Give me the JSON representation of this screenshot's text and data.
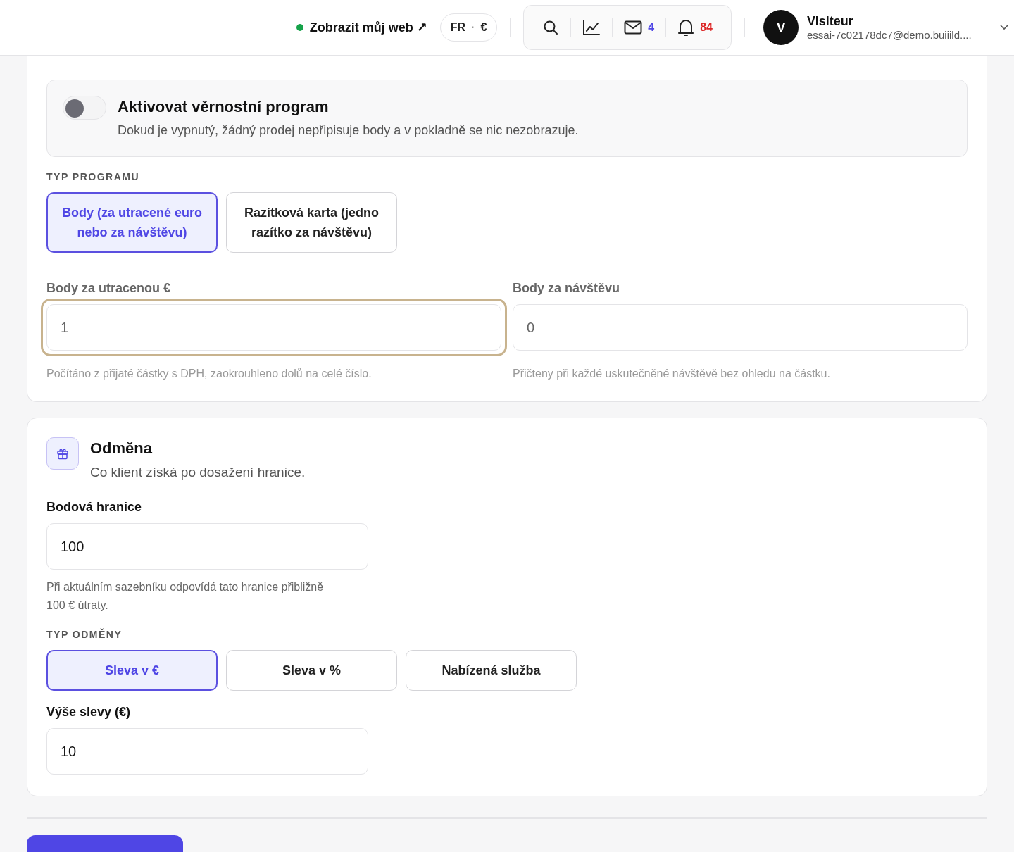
{
  "header": {
    "site_link": "Zobrazit můj web ↗",
    "site_online": true,
    "locale": "FR",
    "separator": "·",
    "currency": "€",
    "mail_count": "4",
    "notification_count": "84",
    "user": {
      "initial": "V",
      "name": "Visiteur",
      "email": "essai-7c02178dc7@demo.buiiild...."
    }
  },
  "program": {
    "toggle": {
      "title": "Aktivovat věrnostní program",
      "description": "Dokud je vypnutý, žádný prodej nepřipisuje body a v pokladně se nic nezobrazuje.",
      "on": false
    },
    "type_label": "TYP PROGRAMU",
    "types": [
      {
        "label": "Body (za utracené euro nebo za návštěvu)",
        "selected": true
      },
      {
        "label": "Razítková karta (jedno razítko za návštěvu)",
        "selected": false
      }
    ],
    "fields": [
      {
        "label": "Body za utracenou €",
        "value": "1",
        "hint": "Počítáno z přijaté částky s DPH, zaokrouhleno dolů na celé číslo.",
        "focused": true
      },
      {
        "label": "Body za návštěvu",
        "value": "0",
        "hint": "Přičteny při každé uskutečněné návštěvě bez ohledu na částku.",
        "focused": false
      }
    ]
  },
  "reward": {
    "title": "Odměna",
    "subtitle": "Co klient získá po dosažení hranice.",
    "threshold_label": "Bodová hranice",
    "threshold_value": "100",
    "threshold_hint": "Při aktuálním sazebníku odpovídá tato hranice přibližně 100 € útraty.",
    "type_label": "TYP ODMĚNY",
    "types": [
      {
        "label": "Sleva v €",
        "selected": true
      },
      {
        "label": "Sleva v %",
        "selected": false
      },
      {
        "label": "Nabízená služba",
        "selected": false
      }
    ],
    "amount_label": "Výše slevy (€)",
    "amount_value": "10"
  }
}
